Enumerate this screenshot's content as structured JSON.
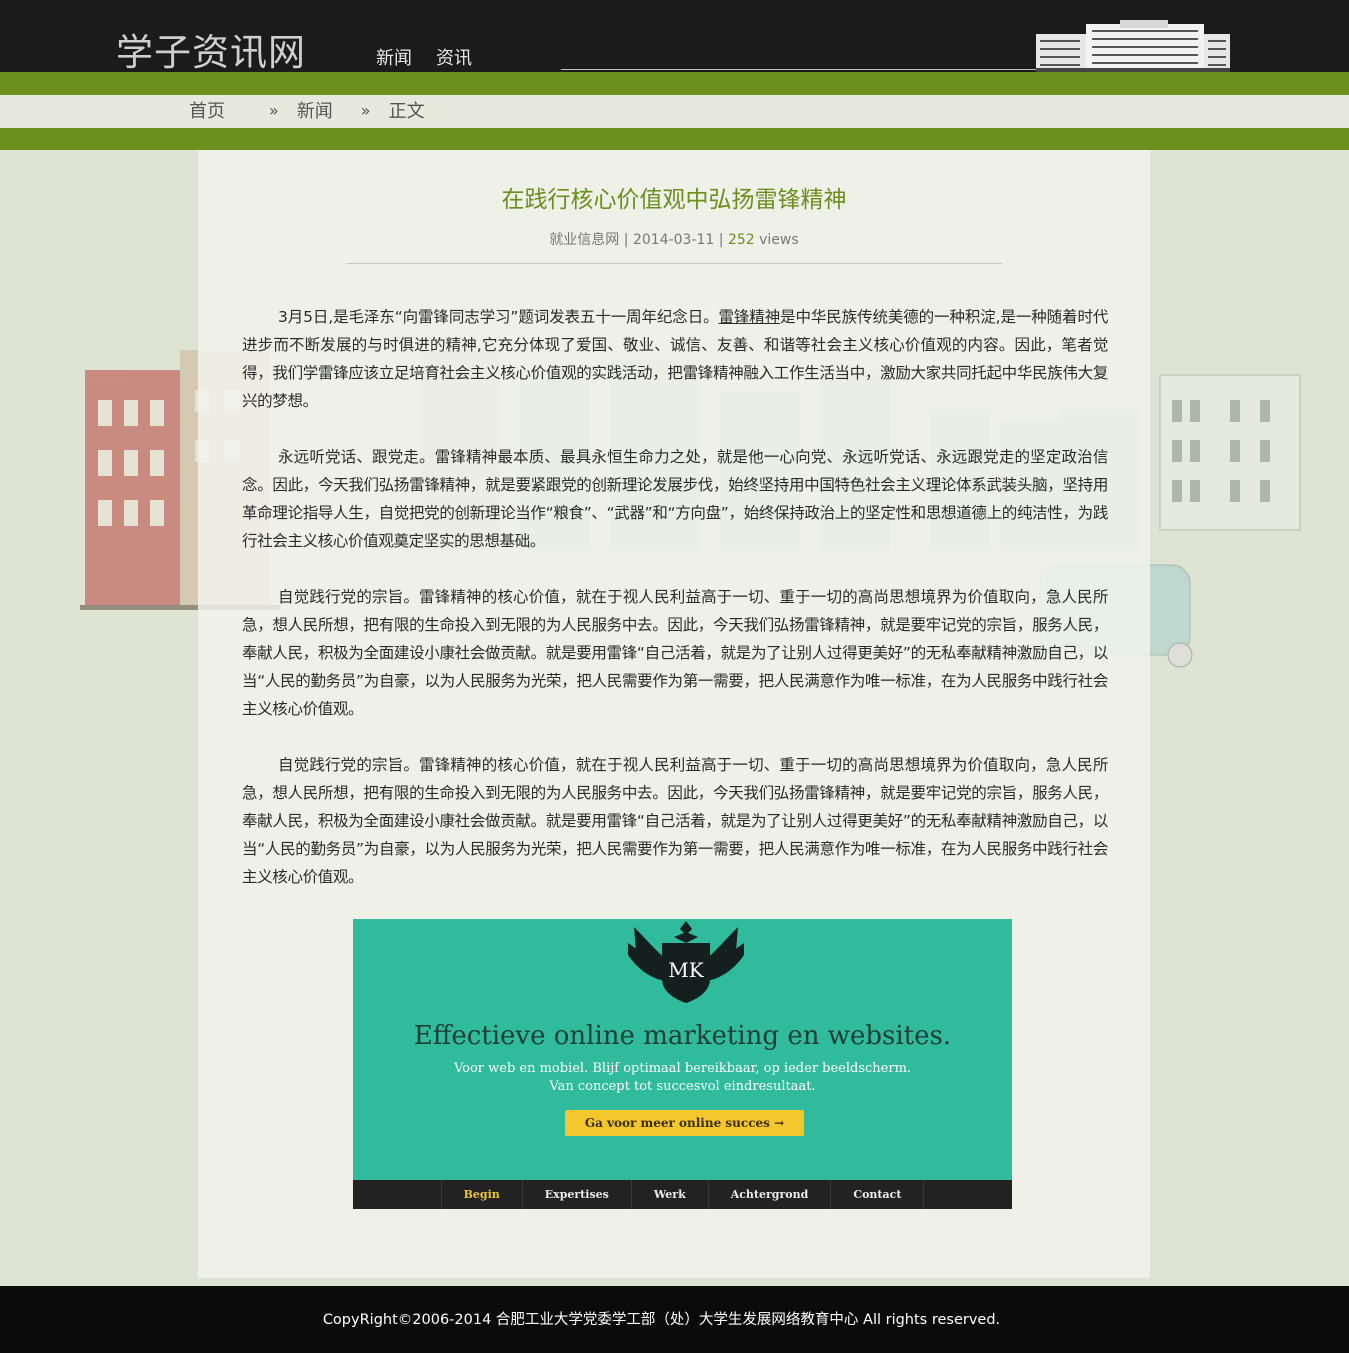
{
  "header": {
    "logo": "学子资讯网",
    "nav": [
      "新闻",
      "资讯"
    ]
  },
  "breadcrumb": {
    "items": [
      "首页",
      "新闻",
      "正文"
    ],
    "separator": "»"
  },
  "article": {
    "title": "在践行核心价值观中弘扬雷锋精神",
    "source": "就业信息网",
    "divider": "|",
    "date": "2014-03-11",
    "views_count": "252",
    "views_label": "views",
    "p1_before": "3月5日,是毛泽东“向雷锋同志学习”题词发表五十一周年纪念日。",
    "p1_keyword": "雷锋精神",
    "p1_after": "是中华民族传统美德的一种积淀,是一种随着时代进步而不断发展的与时俱进的精神,它充分体现了爱国、敬业、诚信、友善、和谐等社会主义核心价值观的内容。因此，笔者觉得，我们学雷锋应该立足培育社会主义核心价值观的实践活动，把雷锋精神融入工作生活当中，激励大家共同托起中华民族伟大复兴的梦想。",
    "p2": "永远听党话、跟党走。雷锋精神最本质、最具永恒生命力之处，就是他一心向党、永远听党话、永远跟党走的坚定政治信念。因此，今天我们弘扬雷锋精神，就是要紧跟党的创新理论发展步伐，始终坚持用中国特色社会主义理论体系武装头脑，坚持用革命理论指导人生，自觉把党的创新理论当作“粮食”、“武器”和“方向盘”，始终保持政治上的坚定性和思想道德上的纯洁性，为践行社会主义核心价值观奠定坚实的思想基础。",
    "p3": "自觉践行党的宗旨。雷锋精神的核心价值，就在于视人民利益高于一切、重于一切的高尚思想境界为价值取向，急人民所急，想人民所想，把有限的生命投入到无限的为人民服务中去。因此，今天我们弘扬雷锋精神，就是要牢记党的宗旨，服务人民，奉献人民，积极为全面建设小康社会做贡献。就是要用雷锋“自己活着，就是为了让别人过得更美好”的无私奉献精神激励自己，以当“人民的勤务员”为自豪，以为人民服务为光荣，把人民需要作为第一需要，把人民满意作为唯一标准，在为人民服务中践行社会主义核心价值观。",
    "p4": "自觉践行党的宗旨。雷锋精神的核心价值，就在于视人民利益高于一切、重于一切的高尚思想境界为价值取向，急人民所急，想人民所想，把有限的生命投入到无限的为人民服务中去。因此，今天我们弘扬雷锋精神，就是要牢记党的宗旨，服务人民，奉献人民，积极为全面建设小康社会做贡献。就是要用雷锋“自己活着，就是为了让别人过得更美好”的无私奉献精神激励自己，以当“人民的勤务员”为自豪，以为人民服务为光荣，把人民需要作为第一需要，把人民满意作为唯一标准，在为人民服务中践行社会主义核心价值观。"
  },
  "ad": {
    "logo_text": "MK",
    "headline": "Effectieve online marketing en websites.",
    "sub1": "Voor web en mobiel. Blijf optimaal bereikbaar, op ieder beeldscherm.",
    "sub2": "Van concept tot succesvol eindresultaat.",
    "cta": "Ga voor meer online succes →",
    "nav": [
      "Begin",
      "Expertises",
      "Werk",
      "Achtergrond",
      "Contact"
    ],
    "colors": {
      "background": "#2fbb9c",
      "button": "#f2c62c",
      "nav_bg": "#222222",
      "nav_active": "#f0c33a"
    }
  },
  "footer": {
    "text": "CopyRight©2006-2014 合肥工业大学党委学工部（处）大学生发展网络教育中心 All rights reserved."
  },
  "colors": {
    "brand_green": "#6c8f1d",
    "header_bg": "#1b1b1b",
    "footer_bg": "#0b0b0b"
  }
}
